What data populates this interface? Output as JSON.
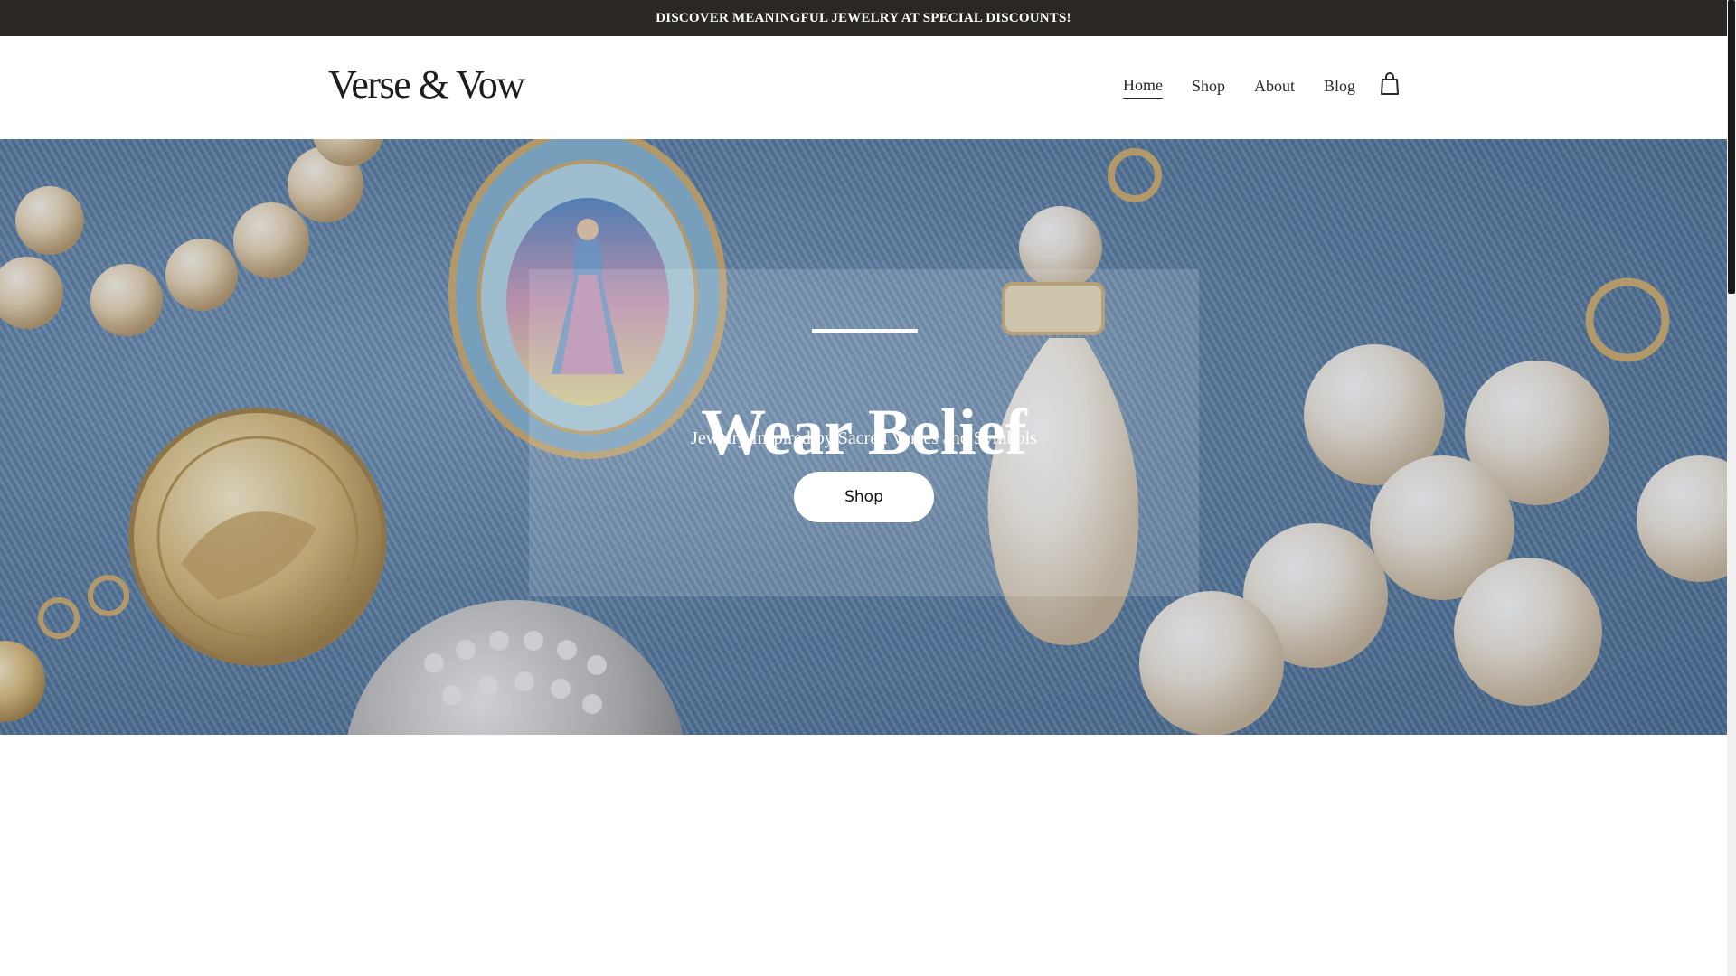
{
  "announcement": {
    "text": "DISCOVER MEANINGFUL JEWELRY AT SPECIAL DISCOUNTS!"
  },
  "header": {
    "logo": "Verse & Vow",
    "nav": [
      {
        "label": "Home",
        "active": true
      },
      {
        "label": "Shop",
        "active": false
      },
      {
        "label": "About",
        "active": false
      },
      {
        "label": "Blog",
        "active": false
      }
    ],
    "cart_icon": "shopping-bag-icon"
  },
  "hero": {
    "title": "Wear Belief",
    "subtitle": "Jewelry Inspired by Sacred Verses and Symbols",
    "button_label": "Shop",
    "colors": {
      "denim": "#5a7ea3",
      "pearl": "#f1ebe0",
      "gold": "#d2b071"
    }
  },
  "colors": {
    "announcement_bg": "#2b2724",
    "text_dark": "#2a2a2a",
    "white": "#ffffff"
  }
}
